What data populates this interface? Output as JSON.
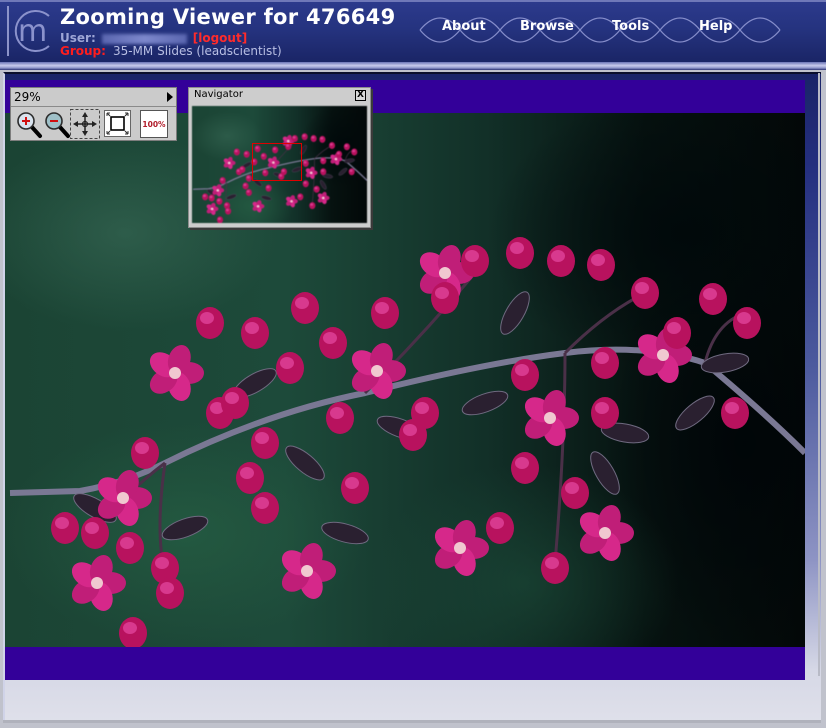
{
  "header": {
    "title": "Zooming Viewer for 476649",
    "user_label": "User:",
    "user_name_redacted": true,
    "logout_label": "[logout]",
    "group_label": "Group:",
    "group_value": "35-MM Slides (leadscientist)",
    "logo_icon": "m-circle-logo"
  },
  "nav": {
    "items": [
      {
        "label": "About"
      },
      {
        "label": "Browse"
      },
      {
        "label": "Tools"
      },
      {
        "label": "Help"
      }
    ]
  },
  "zoom_toolbar": {
    "zoom_level": "29%",
    "tools": [
      {
        "name": "zoom-in",
        "icon": "magnifier-plus-icon"
      },
      {
        "name": "zoom-out",
        "icon": "magnifier-minus-icon"
      },
      {
        "name": "pan",
        "icon": "move-arrows-icon",
        "active": true
      },
      {
        "name": "fit-to-window",
        "icon": "fit-window-icon"
      },
      {
        "name": "actual-size",
        "icon": "hundred-percent-icon",
        "label": "100%"
      }
    ]
  },
  "navigator": {
    "title": "Navigator",
    "close_label": "X"
  },
  "viewer": {
    "subject": "crabapple blossoms branch on dark green background",
    "letterbox_color": "#330099"
  },
  "colors": {
    "header_bg": "#25337f",
    "accent_red": "#ff1d1d",
    "viewport_rect": "#e00000",
    "flower_magenta": "#d0217e"
  }
}
